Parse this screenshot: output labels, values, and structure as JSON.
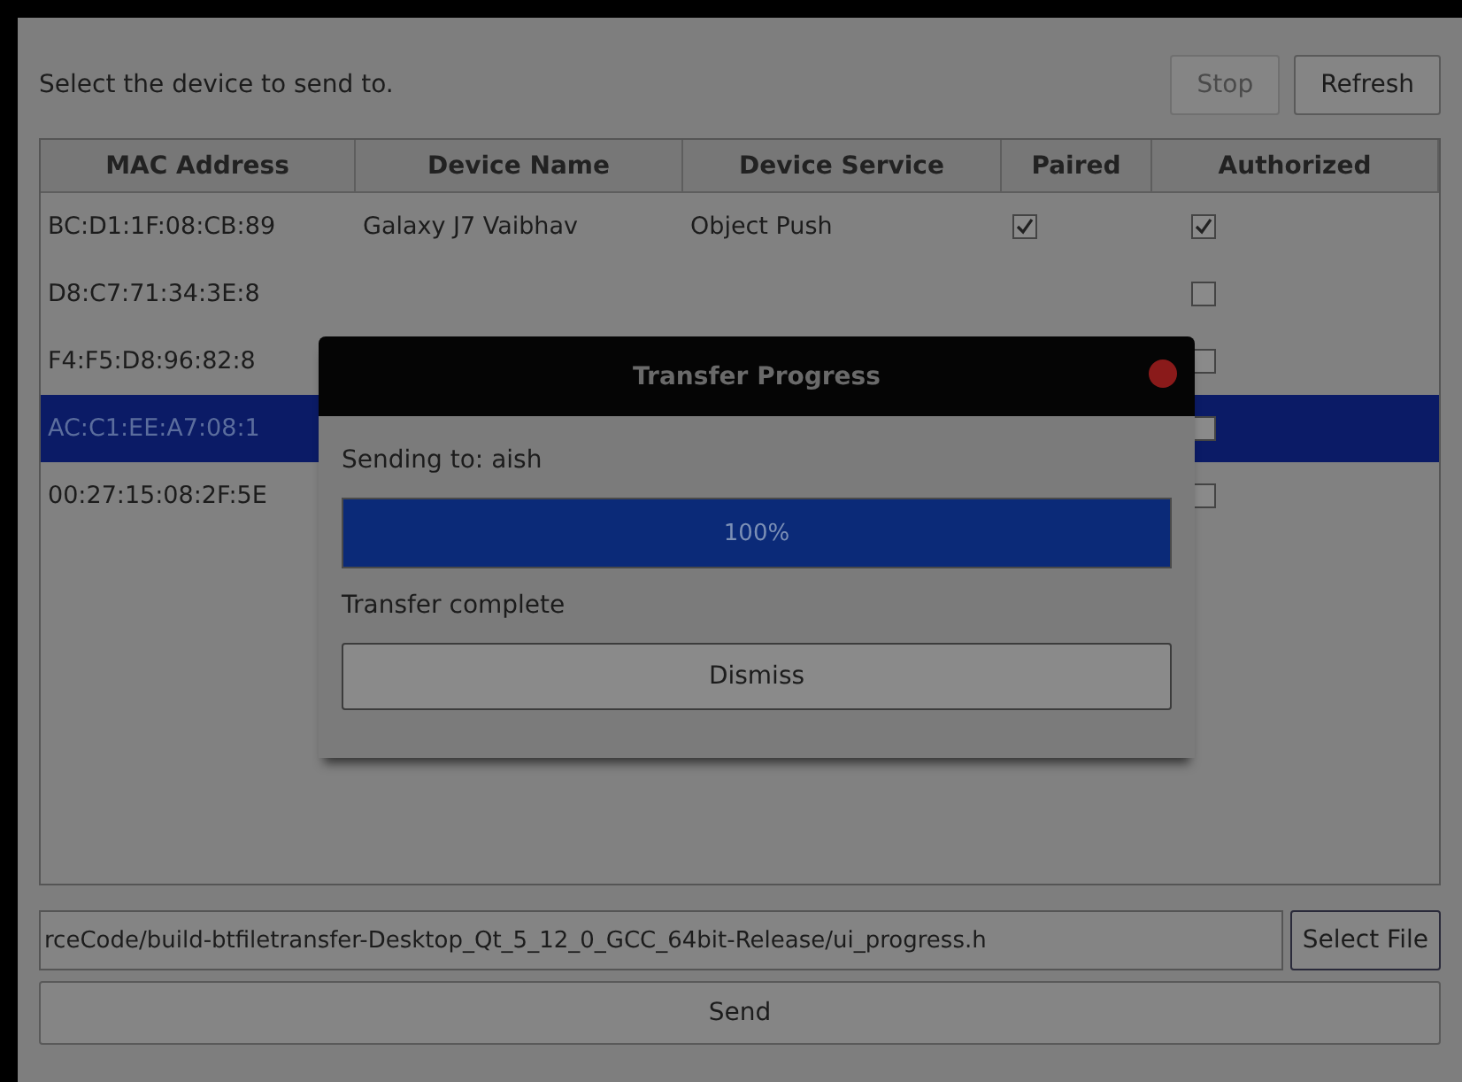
{
  "header": {
    "prompt": "Select the device to send to.",
    "buttons": [
      {
        "label": "Stop",
        "disabled": true
      },
      {
        "label": "Refresh",
        "disabled": false
      }
    ]
  },
  "table": {
    "columns": [
      "MAC Address",
      "Device Name",
      "Device Service",
      "Paired",
      "Authorized"
    ],
    "rows": [
      {
        "mac": "BC:D1:1F:08:CB:89",
        "name": "Galaxy J7 Vaibhav",
        "service": "Object Push",
        "paired": true,
        "authorized": true,
        "selected": false
      },
      {
        "mac": "D8:C7:71:34:3E:8",
        "authorized": false,
        "selected": false
      },
      {
        "mac": "F4:F5:D8:96:82:8",
        "authorized": false,
        "selected": false
      },
      {
        "mac": "AC:C1:EE:A7:08:1",
        "authorized": false,
        "selected": true
      },
      {
        "mac": "00:27:15:08:2F:5E",
        "authorized": false,
        "selected": false
      }
    ]
  },
  "file": {
    "value": "rceCode/build-btfiletransfer-Desktop_Qt_5_12_0_GCC_64bit-Release/ui_progress.h",
    "button": "Select File"
  },
  "send_button": "Send",
  "dialog": {
    "title": "Transfer Progress",
    "sending": "Sending to: aish",
    "level": 1.0,
    "reading": "100%",
    "status": "Transfer complete",
    "button": "Dismiss"
  }
}
